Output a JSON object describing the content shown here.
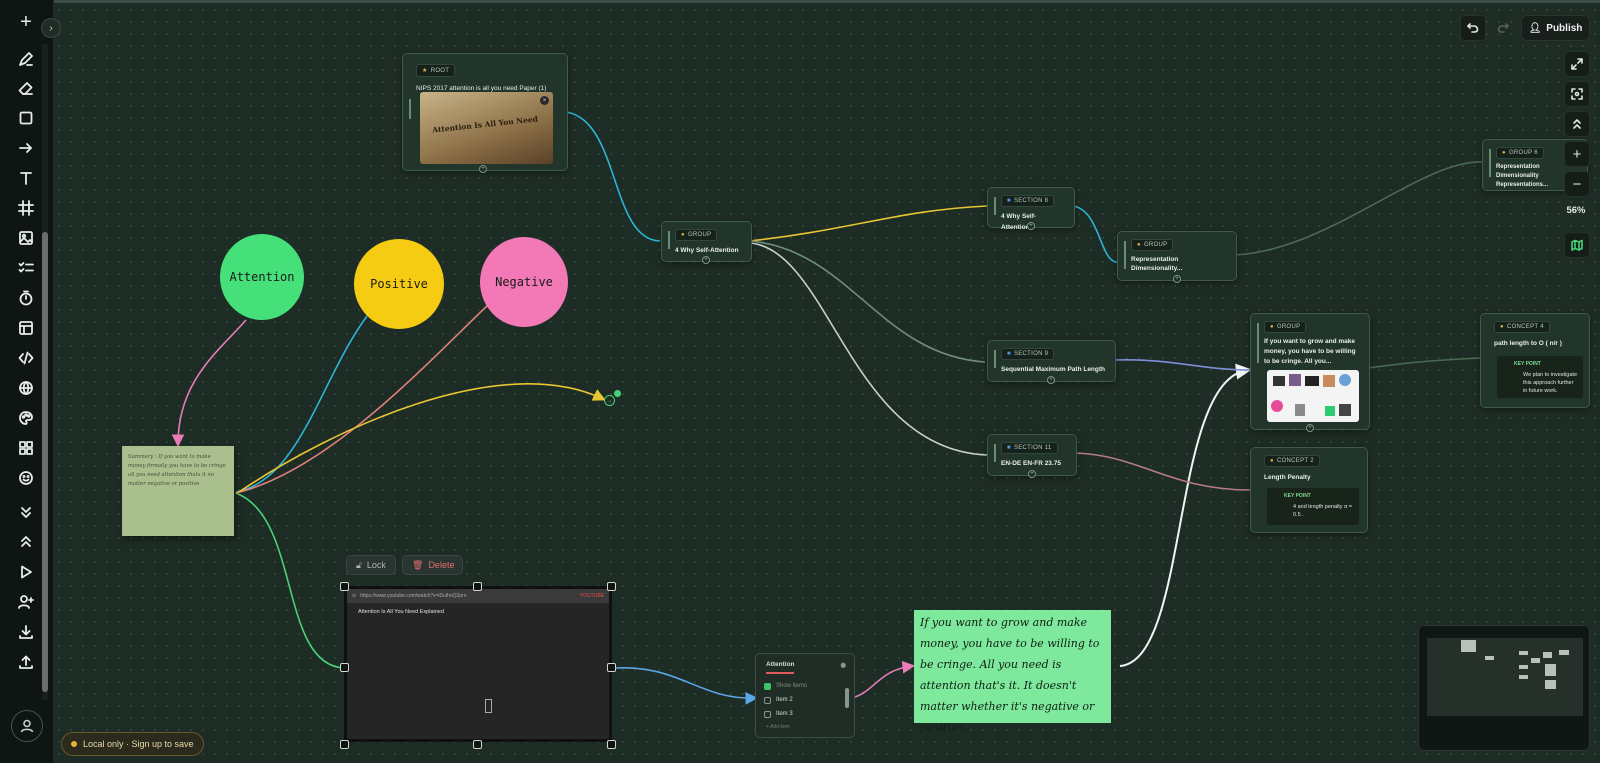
{
  "sidebar": {
    "tools": [
      "add-icon",
      "pen-icon",
      "eraser-icon",
      "rectangle-icon",
      "arrow-icon",
      "text-icon",
      "frame-icon",
      "image-icon",
      "checklist-icon",
      "timer-icon",
      "table-icon",
      "code-icon",
      "globe-icon",
      "palette-icon",
      "grid-icon",
      "emoji-icon",
      "chevrons-down-icon",
      "chevrons-up-icon",
      "play-icon",
      "add-user-icon",
      "download-icon",
      "upload-icon"
    ]
  },
  "header": {
    "publish_label": "Publish"
  },
  "zoom": {
    "level": "56%"
  },
  "status": {
    "local_label": "Local only · Sign up to save"
  },
  "circles": {
    "attention": "Attention",
    "positive": "Positive",
    "negative": "Negative"
  },
  "sticky": {
    "text": "Summary : If you want to make money firmaily you have to be cringe all you need attention thats it no matter negative or positive"
  },
  "note": {
    "text": "If you want to grow and make money, you have to be willing to be cringe. All you need is attention that's it. It doesn't matter whether it's negative or positive."
  },
  "video_controls": {
    "lock": "Lock",
    "delete": "Delete"
  },
  "video": {
    "url": "https://www.youtube.com/watch?v=iDulhoQ2pro",
    "brand": "YOUTUBE",
    "title": "Attention Is All You Need Explained"
  },
  "todo": {
    "title": "Attention",
    "items": [
      {
        "label": "Show items",
        "checked": true
      },
      {
        "label": "Item 2",
        "checked": false
      },
      {
        "label": "Item 3",
        "checked": false
      }
    ],
    "add_label": "+ Add item"
  },
  "nodes": {
    "root": {
      "tag": "ROOT",
      "title": "NIPS 2017 attention is all you need Paper (1)",
      "image_caption": "Attention Is All You Need"
    },
    "group_why": {
      "tag": "GROUP",
      "title": "4 Why Self-Attention"
    },
    "section8": {
      "tag": "SECTION 8",
      "title": "4 Why Self-Attention"
    },
    "group_rep": {
      "tag": "GROUP",
      "title": "Representation Dimensionality..."
    },
    "group6": {
      "tag": "GROUP 6",
      "title": "Representation Dimensionality Representations..."
    },
    "section9": {
      "tag": "SECTION 9",
      "title": "Sequential Maximum Path Length"
    },
    "section11": {
      "tag": "SECTION 11",
      "title": "EN-DE EN-FR 23.75"
    },
    "group_cringe": {
      "tag": "GROUP",
      "title": "If you want to grow and make money, you have to be willing to be cringe. All you..."
    },
    "concept4": {
      "tag": "CONCEPT 4",
      "title": "path length to O ( n/r )",
      "kp_label": "KEY POINT",
      "kp_text": "We plan to investigate this approach further in future work."
    },
    "concept2": {
      "tag": "CONCEPT 2",
      "title": "Length Penalty",
      "kp_label": "KEY POINT",
      "kp_text": "4 and length penalty α = 0.5 ."
    }
  },
  "colors": {
    "attention_circle": "#46e07a",
    "positive_circle": "#f5cc12",
    "negative_circle": "#f278b6",
    "note_bg": "#7ee89c",
    "sticky_bg": "#a9bf8d"
  }
}
